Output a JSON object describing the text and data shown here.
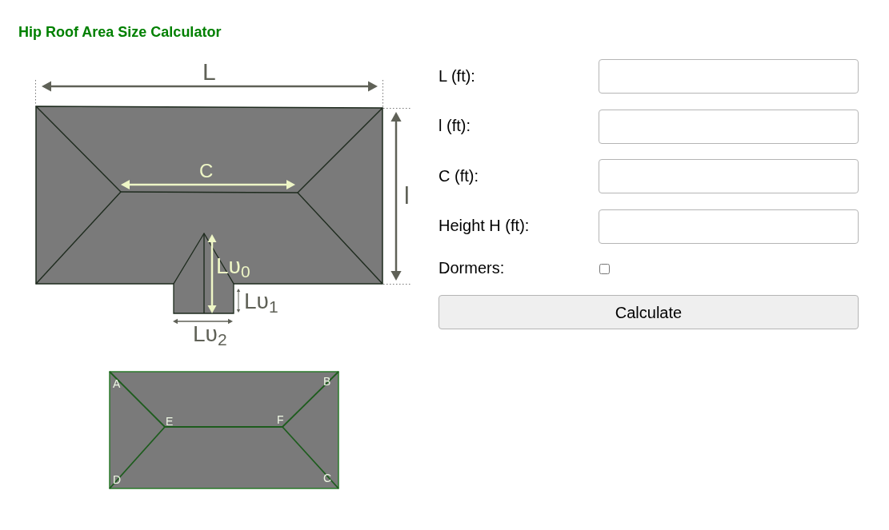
{
  "title": "Hip Roof Area Size Calculator",
  "diagrams": [
    {
      "kind": "dimensions",
      "labels": [
        "L",
        "C",
        "l",
        "Lυ$_{0}$",
        "Lυ$_{1}$",
        "Lυ$_{2}$"
      ]
    },
    {
      "kind": "corner_points",
      "labels": [
        "A",
        "B",
        "E",
        "F",
        "D",
        "C"
      ]
    }
  ],
  "form": {
    "fields": [
      {
        "kind": "text",
        "label": "L (ft):"
      },
      {
        "kind": "text",
        "label": "l (ft):"
      },
      {
        "kind": "text",
        "label": "C (ft):"
      },
      {
        "kind": "text",
        "label": "Height H (ft):"
      },
      {
        "kind": "checkbox",
        "label": "Dormers:",
        "checked": false
      }
    ],
    "button": "Calculate"
  }
}
